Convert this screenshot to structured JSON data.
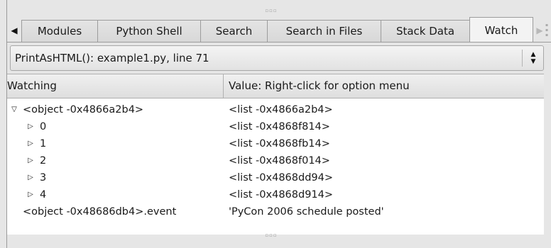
{
  "tabs": [
    {
      "label": "Modules",
      "active": false
    },
    {
      "label": "Python Shell",
      "active": false
    },
    {
      "label": "Search",
      "active": false
    },
    {
      "label": "Search in Files",
      "active": false
    },
    {
      "label": "Stack Data",
      "active": false
    },
    {
      "label": "Watch",
      "active": true
    }
  ],
  "context": {
    "selected": "PrintAsHTML(): example1.py, line 71"
  },
  "table": {
    "columns": [
      "Watching",
      "Value:  Right-click for option menu"
    ],
    "rows": [
      {
        "name": "<object -0x4866a2b4>",
        "value": "<list -0x4866a2b4>",
        "expander": "expanded",
        "indent": 0
      },
      {
        "name": "0",
        "value": "<list -0x4868f814>",
        "expander": "collapsed",
        "indent": 1
      },
      {
        "name": "1",
        "value": "<list -0x4868fb14>",
        "expander": "collapsed",
        "indent": 1
      },
      {
        "name": "2",
        "value": "<list -0x4868f014>",
        "expander": "collapsed",
        "indent": 1
      },
      {
        "name": "3",
        "value": "<list -0x4868dd94>",
        "expander": "collapsed",
        "indent": 1
      },
      {
        "name": "4",
        "value": "<list -0x4868d914>",
        "expander": "collapsed",
        "indent": 1
      },
      {
        "name": "<object -0x48686db4>.event",
        "value": "'PyCon 2006 schedule posted'",
        "expander": "none",
        "indent": 0
      }
    ]
  },
  "icons": {
    "tab_scroll_left": "triangle-left-icon",
    "tab_scroll_right": "triangle-right-icon",
    "context_dropdown": "up-down-arrows-icon",
    "row_expanded": "triangle-down-outline-icon",
    "row_collapsed": "triangle-right-outline-icon"
  },
  "colors": {
    "tab_active": "#f3f3f3",
    "tab_inactive": "#dcdcdc",
    "border": "#9c9c9c",
    "table_background": "#ffffff"
  }
}
